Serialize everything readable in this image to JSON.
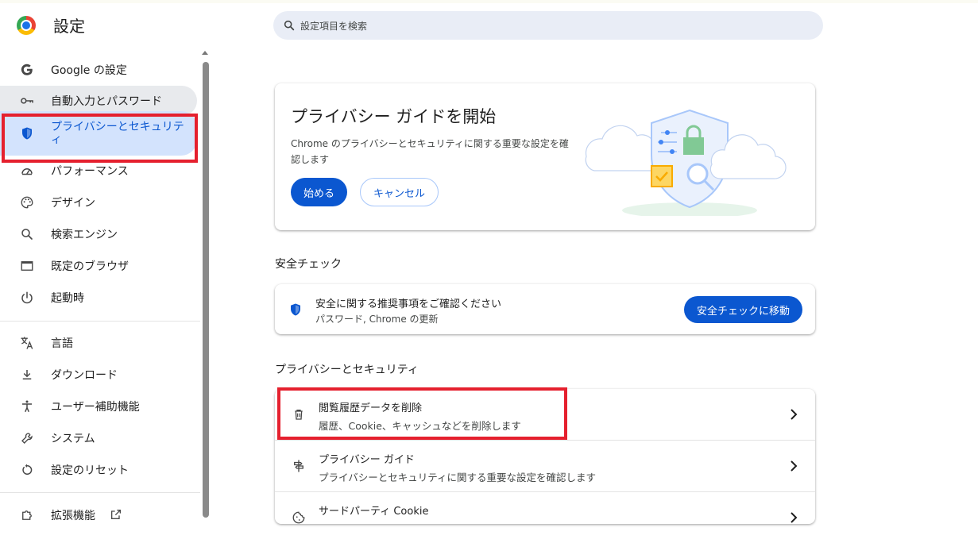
{
  "header": {
    "title": "設定",
    "search_placeholder": "設定項目を検索"
  },
  "sidebar": {
    "items": [
      {
        "label": "Google の設定",
        "icon": "google-g-icon"
      },
      {
        "label": "自動入力とパスワード",
        "icon": "key-icon"
      },
      {
        "label": "プライバシーとセキュリティ",
        "icon": "shield-icon"
      },
      {
        "label": "パフォーマンス",
        "icon": "speedometer-icon"
      },
      {
        "label": "デザイン",
        "icon": "palette-icon"
      },
      {
        "label": "検索エンジン",
        "icon": "search-icon"
      },
      {
        "label": "既定のブラウザ",
        "icon": "browser-window-icon"
      },
      {
        "label": "起動時",
        "icon": "power-icon"
      },
      {
        "label": "言語",
        "icon": "translate-icon"
      },
      {
        "label": "ダウンロード",
        "icon": "download-icon"
      },
      {
        "label": "ユーザー補助機能",
        "icon": "accessibility-icon"
      },
      {
        "label": "システム",
        "icon": "wrench-icon"
      },
      {
        "label": "設定のリセット",
        "icon": "reset-icon"
      },
      {
        "label": "拡張機能",
        "icon": "puzzle-icon"
      }
    ]
  },
  "privacy_guide_card": {
    "title": "プライバシー ガイドを開始",
    "description": "Chrome のプライバシーとセキュリティに関する重要な設定を確認します",
    "start_button": "始める",
    "cancel_button": "キャンセル"
  },
  "safety_check": {
    "section_title": "安全チェック",
    "line1": "安全に関する推奨事項をご確認ください",
    "line2": "パスワード, Chrome の更新",
    "button": "安全チェックに移動"
  },
  "privacy_security": {
    "section_title": "プライバシーとセキュリティ",
    "rows": [
      {
        "title": "閲覧履歴データを削除",
        "subtitle": "履歴、Cookie、キャッシュなどを削除します",
        "icon": "trash-icon"
      },
      {
        "title": "プライバシー ガイド",
        "subtitle": "プライバシーとセキュリティに関する重要な設定を確認します",
        "icon": "guide-icon"
      },
      {
        "title": "サードパーティ Cookie",
        "subtitle": "",
        "icon": "cookie-icon"
      }
    ]
  },
  "colors": {
    "accent": "#0b57d0",
    "active_bg": "#d3e3fd",
    "highlight_border": "#e5202e"
  }
}
